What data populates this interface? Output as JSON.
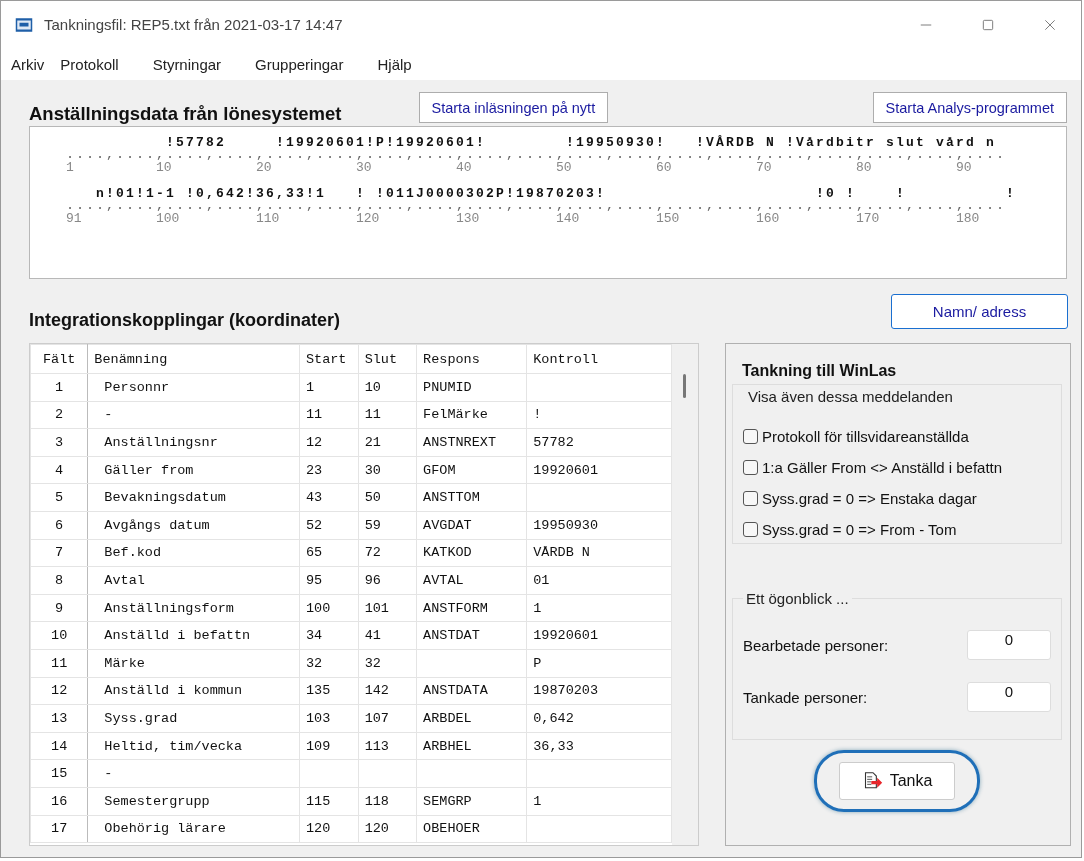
{
  "window": {
    "title": "Tankningsfil: REP5.txt från 2021-03-17 14:47"
  },
  "menu": [
    "Arkiv",
    "Protokoll",
    "Styrningar",
    "Grupperingar",
    "Hjälp"
  ],
  "import_section": {
    "title": "Anställningsdata från lönesystemet",
    "buttons": [
      "Starta inläsningen på nytt",
      "Starta Analys-programmet"
    ],
    "lines": [
      {
        "text": "          !57782     !19920601!P!19920601!        !19950930!   !VÅRDB N !Vårdbitr slut vård n",
        "scale": "....,....,....,....,....,....,....,....,....,....,....,....,....,....,....,....,....,....,....",
        "numbers": [
          "1",
          "10",
          "20",
          "30",
          "40",
          "50",
          "60",
          "70",
          "80",
          "90"
        ]
      },
      {
        "text": "   n!01!1-1 !0,642!36,33!1   ! !011J0000302P!19870203!                     !0 !    !          !",
        "scale": "....,....,....,....,....,....,....,....,....,....,....,....,....,....,....,....,....,....,....",
        "numbers": [
          "91",
          "100",
          "110",
          "120",
          "130",
          "140",
          "150",
          "160",
          "170",
          "180"
        ]
      }
    ]
  },
  "integration": {
    "title": "Integrationskopplingar (koordinater)",
    "button": "Namn/ adress",
    "columns": [
      "Fält",
      "Benämning",
      "Start",
      "Slut",
      "Respons",
      "Kontroll"
    ],
    "rows": [
      [
        "1",
        "Personnr",
        "1",
        "10",
        "PNUMID",
        null
      ],
      [
        "2",
        "-",
        "11",
        "11",
        "FelMärke",
        "!"
      ],
      [
        "3",
        "Anställningsnr",
        "12",
        "21",
        "ANSTNREXT",
        "57782"
      ],
      [
        "4",
        "Gäller from",
        "23",
        "30",
        "GFOM",
        "19920601"
      ],
      [
        "5",
        "Bevakningsdatum",
        "43",
        "50",
        "ANSTTOM",
        null
      ],
      [
        "6",
        "Avgångs datum",
        "52",
        "59",
        "AVGDAT",
        "19950930"
      ],
      [
        "7",
        "Bef.kod",
        "65",
        "72",
        "KATKOD",
        "VÅRDB N"
      ],
      [
        "8",
        "Avtal",
        "95",
        "96",
        "AVTAL",
        "01"
      ],
      [
        "9",
        "Anställningsform",
        "100",
        "101",
        "ANSTFORM",
        "1"
      ],
      [
        "10",
        "Anställd i befattn",
        "34",
        "41",
        "ANSTDAT",
        "19920601"
      ],
      [
        "11",
        "Märke",
        "32",
        "32",
        null,
        "P"
      ],
      [
        "12",
        "Anställd i kommun",
        "135",
        "142",
        "ANSTDATA",
        "19870203"
      ],
      [
        "13",
        "Syss.grad",
        "103",
        "107",
        "ARBDEL",
        "0,642"
      ],
      [
        "14",
        "Heltid, tim/vecka",
        "109",
        "113",
        "ARBHEL",
        "36,33"
      ],
      [
        "15",
        "-",
        null,
        null,
        null,
        null
      ],
      [
        "16",
        "Semestergrupp",
        "115",
        "118",
        "SEMGRP",
        "1"
      ],
      [
        "17",
        "Obehörig lärare",
        "120",
        "120",
        "OBEHOER",
        null
      ]
    ]
  },
  "panel": {
    "title": "Tankning till WinLas",
    "options_group": {
      "title": "Visa även dessa meddelanden",
      "options": [
        {
          "label": "Protokoll för tillsvidareanställda",
          "checked": false
        },
        {
          "label": "1:a Gäller From <> Anställd i befattn",
          "checked": false
        },
        {
          "label": "Syss.grad = 0  => Enstaka dagar",
          "checked": false
        },
        {
          "label": "Syss.grad = 0  => From - Tom",
          "checked": false
        }
      ]
    },
    "progress_group": {
      "title": "Ett ögonblick ...",
      "counters": [
        {
          "label": "Bearbetade personer:",
          "value": "0"
        },
        {
          "label": "Tankade personer:",
          "value": "0"
        }
      ]
    },
    "action": {
      "label": "Tanka",
      "highlighted": true
    }
  }
}
